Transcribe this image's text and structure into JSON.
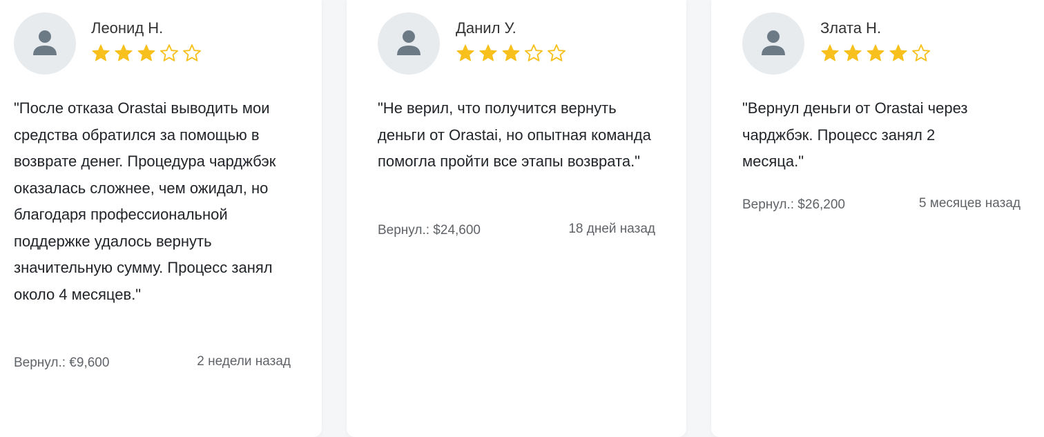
{
  "colors": {
    "star": "#f7c01c",
    "avatar_bg": "#e8ebee",
    "avatar_icon": "#6c7a86",
    "page_bg": "#f5f6f8",
    "card_bg": "#ffffff"
  },
  "reviews": [
    {
      "name": "Леонид Н.",
      "rating": 3,
      "max_rating": 5,
      "avatar_icon": "user-icon",
      "text": "\"После отказа Orastai выводить мои средства обратился за помощью в возврате денег. Процедура чарджбэк оказалась сложнее, чем ожидал, но благодаря профессиональной поддержке удалось вернуть значительную сумму. Процесс занял около 4 месяцев.\"",
      "recovered": "Вернул.: €9,600",
      "time": "2 недели назад"
    },
    {
      "name": "Данил У.",
      "rating": 3,
      "max_rating": 5,
      "avatar_icon": "user-icon",
      "text": "\"Не верил, что получится вернуть деньги от Orastai, но опытная команда помогла пройти все этапы возврата.\"",
      "recovered": "Вернул.: $24,600",
      "time": "18 дней назад"
    },
    {
      "name": "Злата Н.",
      "rating": 4,
      "max_rating": 5,
      "avatar_icon": "user-icon",
      "text": "\"Вернул деньги от Orastai через чарджбэк. Процесс занял 2 месяца.\"",
      "recovered": "Вернул.: $26,200",
      "time": "5 месяцев назад"
    }
  ]
}
